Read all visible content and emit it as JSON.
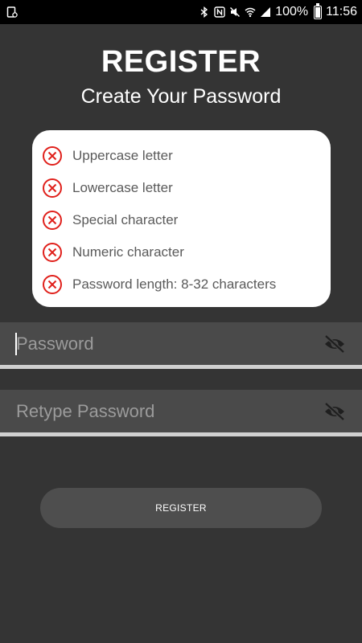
{
  "status_bar": {
    "battery": "100%",
    "time": "11:56",
    "icons": [
      "screenshot-icon",
      "bluetooth-icon",
      "nfc-icon",
      "mute-icon",
      "wifi-icon",
      "signal-icon",
      "battery-icon"
    ]
  },
  "header": {
    "title": "REGISTER",
    "subtitle": "Create Your Password"
  },
  "rules": [
    {
      "label": "Uppercase letter",
      "met": false
    },
    {
      "label": "Lowercase letter",
      "met": false
    },
    {
      "label": "Special character",
      "met": false
    },
    {
      "label": "Numeric character",
      "met": false
    },
    {
      "label": "Password length: 8-32 characters",
      "met": false
    }
  ],
  "form": {
    "password_placeholder": "Password",
    "password_value": "",
    "retype_placeholder": "Retype Password",
    "retype_value": "",
    "register_label": "REGISTER"
  },
  "colors": {
    "background": "#343434",
    "field_background": "#4a4a4a",
    "error_red": "#e0201b",
    "card": "#ffffff"
  }
}
